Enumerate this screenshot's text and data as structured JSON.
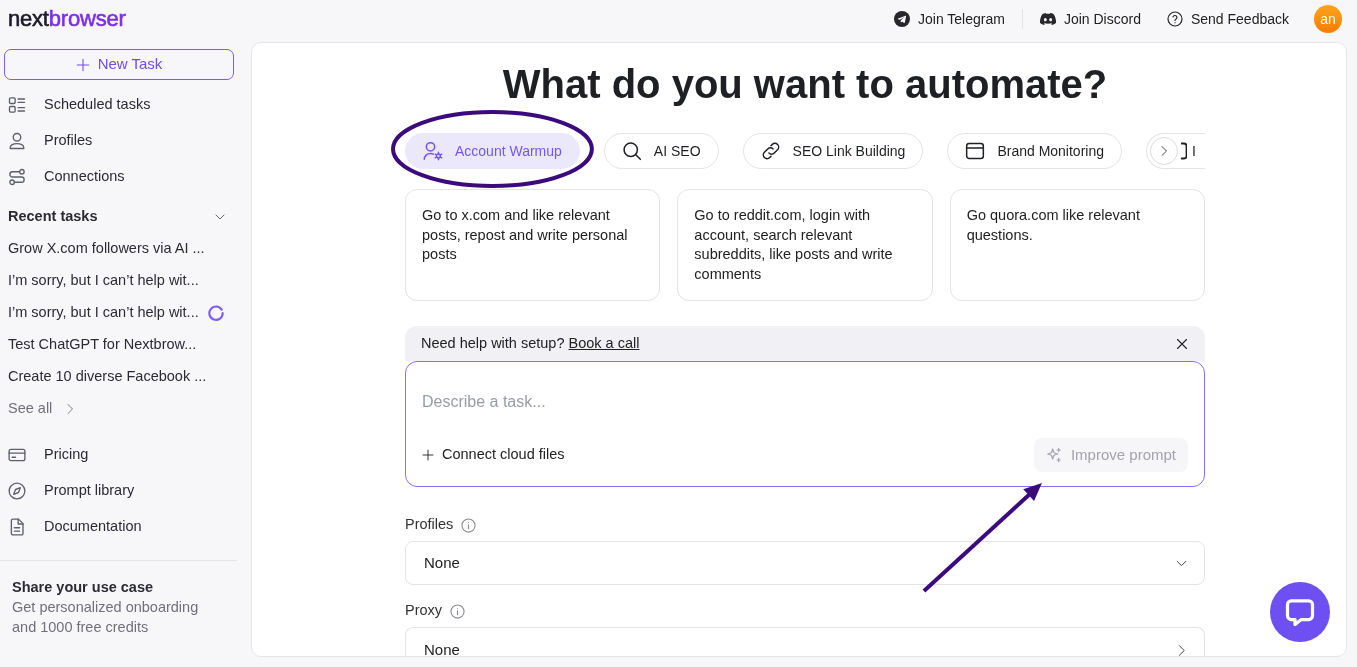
{
  "header": {
    "logo": [
      "next",
      "browser"
    ],
    "links": [
      "Join Telegram",
      "Join Discord",
      "Send Feedback"
    ],
    "avatar": "an"
  },
  "sidebar": {
    "new_task": "New Task",
    "nav": [
      "Scheduled tasks",
      "Profiles",
      "Connections"
    ],
    "recent": {
      "title": "Recent tasks",
      "expanded": true,
      "items": [
        {
          "title": "Grow X.com followers via AI ...",
          "running": false
        },
        {
          "title": "I’m sorry, but I can’t help wit...",
          "running": false
        },
        {
          "title": "I’m sorry, but I can’t help wit...",
          "running": true
        },
        {
          "title": "Test ChatGPT for Nextbrow...",
          "running": false
        },
        {
          "title": "Create 10 diverse Facebook ...",
          "running": false
        }
      ],
      "see_all": "See all"
    },
    "links": [
      "Pricing",
      "Prompt library",
      "Documentation"
    ],
    "promo": {
      "title": "Share your use case",
      "text": "Get personalized onboarding and 1000 free credits"
    }
  },
  "main": {
    "heading": "What do you want to automate?",
    "categories": [
      {
        "label": "Account Warmup",
        "selected": true
      },
      {
        "label": "AI SEO",
        "selected": false
      },
      {
        "label": "SEO Link Building",
        "selected": false
      },
      {
        "label": "Brand Monitoring",
        "selected": false
      },
      {
        "label": "I",
        "selected": false
      }
    ],
    "suggestions": [
      "Go to x.com and like relevant posts, repost and write personal posts",
      "Go to reddit.com, login with account, search relevant subreddits, like posts and write comments",
      "Go quora.com like relevant questions."
    ],
    "setup_banner": {
      "text": "Need help with setup?",
      "link": "Book a call"
    },
    "composer": {
      "placeholder": "Describe a task...",
      "attach": "Connect cloud files",
      "improve": {
        "label": "Improve prompt",
        "disabled": true
      }
    },
    "fields": [
      {
        "label": "Profiles",
        "value": "None",
        "kind": "dropdown"
      },
      {
        "label": "Proxy",
        "value": "None",
        "kind": "submenu"
      }
    ]
  },
  "annotations": [
    {
      "kind": "ellipse"
    },
    {
      "kind": "arrow"
    }
  ]
}
